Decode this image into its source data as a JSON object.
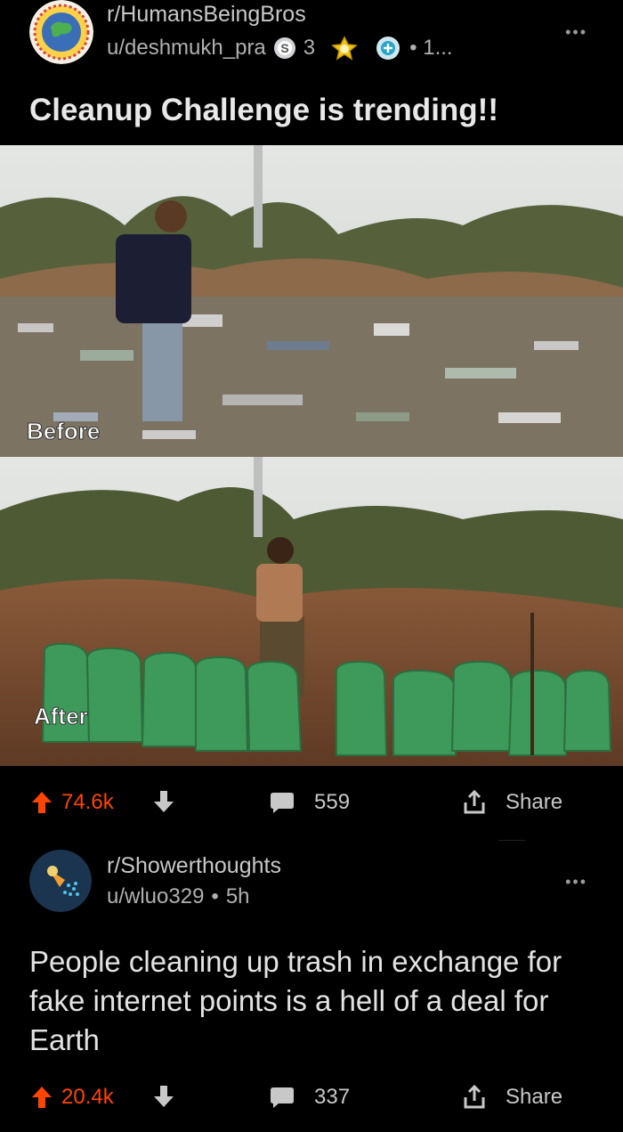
{
  "post1": {
    "subreddit": "r/HumansBeingBros",
    "author": "u/deshmukh_pra",
    "award_count": "3",
    "more_awards": "1...",
    "title": "Cleanup Challenge is trending!!",
    "before_label": "Before",
    "after_label": "After",
    "score": "74.6k",
    "comments": "559",
    "share_label": "Share"
  },
  "post2": {
    "subreddit": "r/Showerthoughts",
    "author": "u/wluo329",
    "age": "5h",
    "title": "People cleaning up trash in exchange for fake internet points is a hell of a deal for Earth",
    "score": "20.4k",
    "comments": "337",
    "share_label": "Share"
  },
  "colors": {
    "background": "#000000",
    "upvote_orange": "#ff4500",
    "text_primary": "#e8e8e8",
    "text_secondary": "#b0b0b0"
  },
  "icons": [
    "upvote-icon",
    "downvote-icon",
    "comment-icon",
    "share-icon",
    "more-icon",
    "silver-award-icon",
    "gold-award-icon",
    "helpful-award-icon",
    "subreddit-avatar-icon"
  ]
}
